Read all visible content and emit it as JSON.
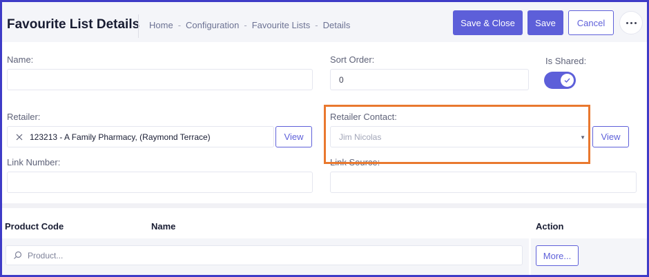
{
  "header": {
    "title": "Favourite List Details",
    "breadcrumb": [
      "Home",
      "Configuration",
      "Favourite Lists",
      "Details"
    ],
    "separator": "-",
    "save_close_label": "Save & Close",
    "save_label": "Save",
    "cancel_label": "Cancel",
    "more_icon": "ellipsis-icon"
  },
  "form": {
    "name": {
      "label": "Name:",
      "value": ""
    },
    "sort_order": {
      "label": "Sort Order:",
      "value": "0"
    },
    "is_shared": {
      "label": "Is Shared:",
      "checked": true
    },
    "retailer": {
      "label": "Retailer:",
      "value": "123213 - A Family Pharmacy, (Raymond Terrace)",
      "view_label": "View"
    },
    "retailer_contact": {
      "label": "Retailer Contact:",
      "value": "Jim Nicolas",
      "view_label": "View"
    },
    "link_number": {
      "label": "Link Number:",
      "value": ""
    },
    "link_source": {
      "label": "Link Source:",
      "value": ""
    }
  },
  "table": {
    "headers": [
      "Product Code",
      "Name",
      "Action"
    ],
    "search_placeholder": "Product...",
    "more_label": "More..."
  },
  "colors": {
    "primary": "#5d5fd9",
    "frame": "#3e3bc7",
    "highlight": "#e9782e"
  }
}
